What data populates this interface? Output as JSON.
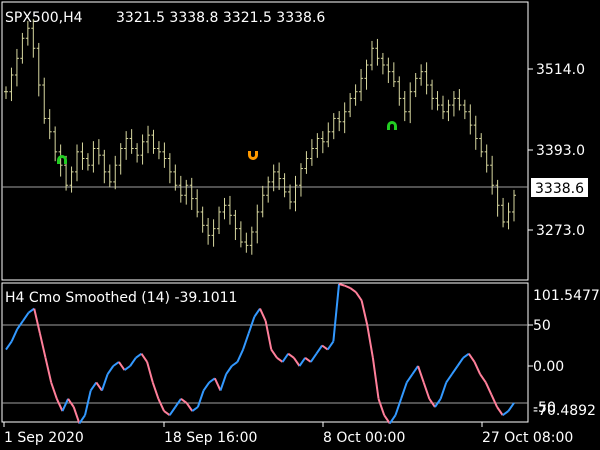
{
  "window": {
    "symbol_header": "SPX500,H4",
    "ohlc": "3321.5 3338.8 3321.5 3338.6"
  },
  "price_axis": {
    "labels": [
      "3514.0",
      "3393.0",
      "3273.0"
    ],
    "current_price": "3338.6"
  },
  "indicator": {
    "title": "H4 Cmo Smoothed (14) -39.1011",
    "axis_labels": [
      "101.5477",
      "50",
      "0.00",
      "-50",
      "-70.4892"
    ],
    "level_high": 50,
    "level_low": -50,
    "up_color": "#3399ff",
    "down_color": "#ff7f9a"
  },
  "time_axis": {
    "labels": [
      "1 Sep 2020",
      "18 Sep 16:00",
      "8 Oct 00:00",
      "27 Oct 08:00"
    ]
  },
  "colors": {
    "bars": "#d8d8a0",
    "grid_line": "#a0a0a0",
    "background": "#000000",
    "up_arrow": "#22cc22",
    "down_arrow": "#ff9900"
  },
  "chart_data": [
    {
      "type": "ohlc",
      "y_axis_ticks": [
        3514.0,
        3393.0,
        3273.0
      ],
      "last_price": 3338.6,
      "close": [
        3480,
        3505,
        3530,
        3560,
        3575,
        3545,
        3490,
        3440,
        3420,
        3390,
        3370,
        3340,
        3360,
        3390,
        3380,
        3370,
        3395,
        3385,
        3360,
        3345,
        3370,
        3395,
        3410,
        3395,
        3385,
        3405,
        3415,
        3395,
        3390,
        3380,
        3360,
        3340,
        3325,
        3340,
        3320,
        3300,
        3280,
        3265,
        3275,
        3300,
        3310,
        3295,
        3275,
        3255,
        3250,
        3270,
        3300,
        3325,
        3345,
        3360,
        3350,
        3330,
        3315,
        3340,
        3365,
        3380,
        3395,
        3410,
        3405,
        3420,
        3440,
        3435,
        3450,
        3470,
        3480,
        3500,
        3520,
        3545,
        3530,
        3520,
        3510,
        3495,
        3470,
        3450,
        3480,
        3500,
        3510,
        3490,
        3470,
        3460,
        3450,
        3460,
        3470,
        3460,
        3450,
        3430,
        3410,
        3390,
        3370,
        3340,
        3310,
        3285,
        3300,
        3325
      ]
    },
    {
      "type": "line",
      "title": "H4 Cmo Smoothed (14) -39.1011",
      "ylim": [
        -70.4892,
        101.5477
      ],
      "reference_lines": [
        50,
        -50
      ],
      "values": [
        20,
        30,
        45,
        55,
        65,
        70,
        40,
        10,
        -20,
        -40,
        -55,
        -40,
        -50,
        -70,
        -60,
        -30,
        -20,
        -30,
        -10,
        0,
        5,
        -5,
        0,
        10,
        15,
        5,
        -20,
        -40,
        -55,
        -60,
        -50,
        -40,
        -45,
        -55,
        -50,
        -30,
        -20,
        -15,
        -30,
        -10,
        0,
        5,
        20,
        40,
        60,
        70,
        55,
        20,
        10,
        5,
        15,
        10,
        0,
        10,
        5,
        15,
        25,
        20,
        30,
        100,
        98,
        95,
        90,
        80,
        50,
        10,
        -40,
        -60,
        -70,
        -60,
        -40,
        -20,
        -10,
        0,
        -20,
        -40,
        -50,
        -40,
        -20,
        -10,
        0,
        10,
        15,
        5,
        -10,
        -20,
        -35,
        -50,
        -60,
        -55,
        -45
      ]
    }
  ]
}
